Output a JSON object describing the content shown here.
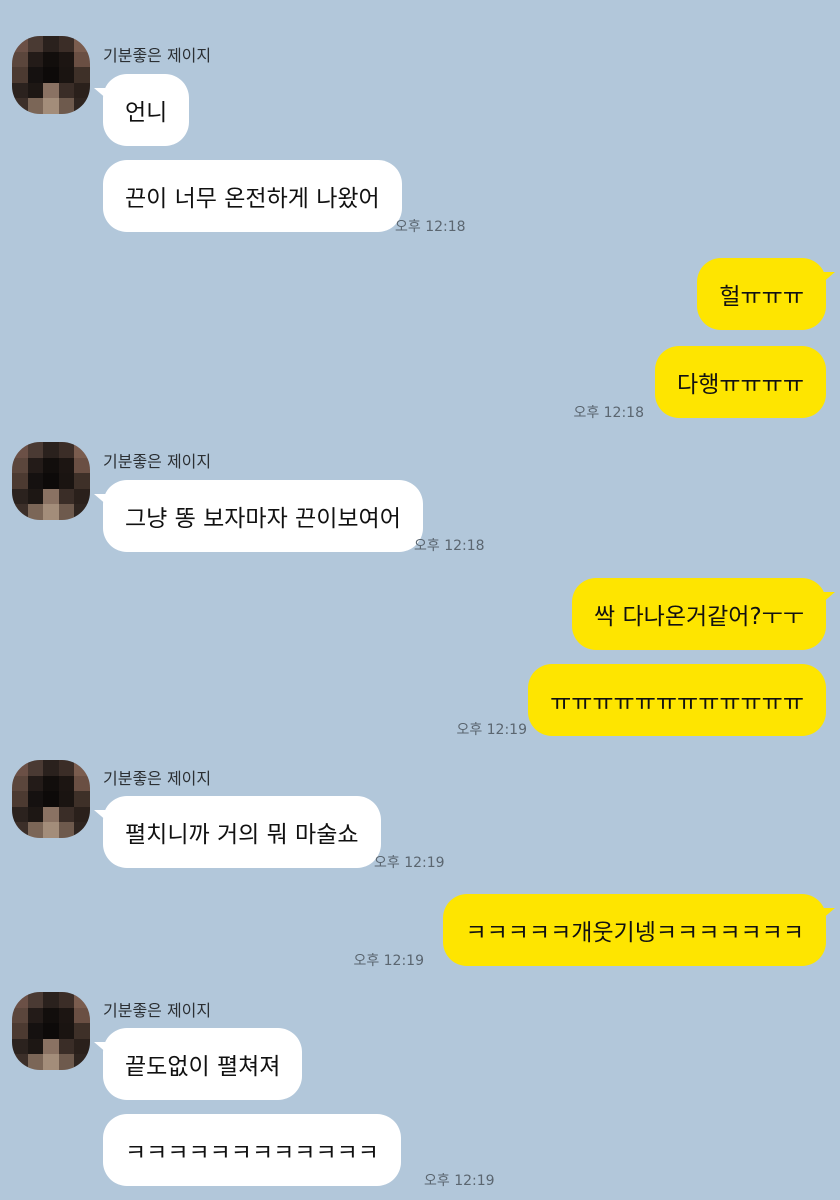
{
  "sender_name": "기분좋은 제이지",
  "groups": [
    {
      "side": "in",
      "messages": [
        "언니",
        "끈이 너무 온전하게 나왔어"
      ],
      "time": "오후 12:18"
    },
    {
      "side": "out",
      "messages": [
        "헐ㅠㅠㅠ",
        "다행ㅠㅠㅠㅠ"
      ],
      "time": "오후 12:18"
    },
    {
      "side": "in",
      "messages": [
        "그냥 똥 보자마자 끈이보여어"
      ],
      "time": "오후 12:18"
    },
    {
      "side": "out",
      "messages": [
        "싹 다나온거같어?ㅜㅜ",
        "ㅠㅠㅠㅠㅠㅠㅠㅠㅠㅠㅠㅠ"
      ],
      "time": "오후 12:19"
    },
    {
      "side": "in",
      "messages": [
        "펼치니까 거의 뭐 마술쇼"
      ],
      "time": "오후 12:19"
    },
    {
      "side": "out",
      "messages": [
        "ㅋㅋㅋㅋㅋ개웃기넹ㅋㅋㅋㅋㅋㅋㅋ"
      ],
      "time": "오후 12:19"
    },
    {
      "side": "in",
      "messages": [
        "끝도없이 펼쳐져",
        "ㅋㅋㅋㅋㅋㅋㅋㅋㅋㅋㅋㅋ"
      ],
      "time": "오후 12:19"
    }
  ],
  "colors": {
    "background": "#b2c7da",
    "incoming": "#ffffff",
    "outgoing": "#fee500"
  }
}
